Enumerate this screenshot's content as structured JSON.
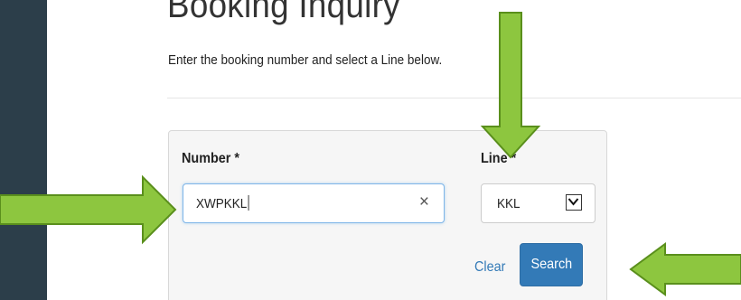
{
  "page": {
    "title": "Booking Inquiry",
    "subtitle": "Enter the booking number and select a Line below."
  },
  "form": {
    "number_label": "Number *",
    "number_value": "XWPKKL",
    "clear_icon": "×",
    "line_label": "Line *",
    "line_selected": "KKL",
    "clear_link": "Clear",
    "search_label": "Search"
  },
  "icons": {
    "clear": "close-icon",
    "select": "chevron-down-icon",
    "annotation": "arrow-icon"
  },
  "colors": {
    "sidebar": "#2c3e4a",
    "primary_button": "#337ab7",
    "link": "#337ab7",
    "annotation_arrow_fill": "#8dc63f",
    "annotation_arrow_stroke": "#5a8f1c",
    "input_focus_border": "#7fb5e8"
  }
}
